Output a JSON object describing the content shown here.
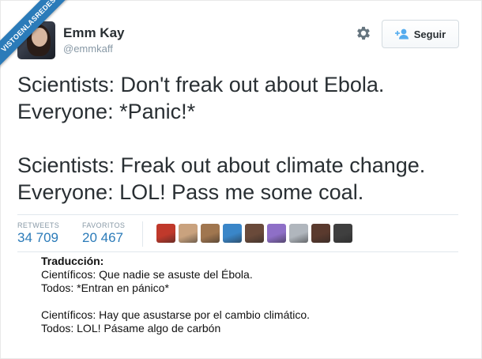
{
  "watermark": {
    "text": "VISTOENLASREDES"
  },
  "profile": {
    "display_name": "Emm Kay",
    "screen_name": "@emmkaff"
  },
  "actions": {
    "settings_icon": "gear-icon",
    "follow_label": "Seguir",
    "follow_icon": "add-person-icon"
  },
  "tweet": {
    "lines": [
      "Scientists: Don't freak out about Ebola.",
      "Everyone: *Panic!*",
      "Scientists: Freak out about climate change.",
      "Everyone: LOL! Pass me some coal."
    ]
  },
  "stats": {
    "retweets_label": "RETWEETS",
    "retweets_value": "34 709",
    "favorites_label": "FAVORITOS",
    "favorites_value": "20 467"
  },
  "facepile": {
    "count": 9,
    "colors": [
      "#c0392b",
      "#c9a27e",
      "#a0764f",
      "#3a86c8",
      "#6a4a3a",
      "#8e6fc7",
      "#b0b6bd",
      "#5a3a2e",
      "#3f3f3f"
    ]
  },
  "translation": {
    "title": "Traducción:",
    "lines": [
      "Científicos: Que nadie se asuste del Ébola.",
      "Todos: *Entran en pánico*",
      "Científicos: Hay que asustarse por el cambio climático.",
      "Todos: LOL! Pásame algo de carbón"
    ]
  },
  "colors": {
    "link_blue": "#2b7bb9",
    "text": "#292f33",
    "muted": "#8899a6",
    "ribbon": "#2b7bb9"
  }
}
